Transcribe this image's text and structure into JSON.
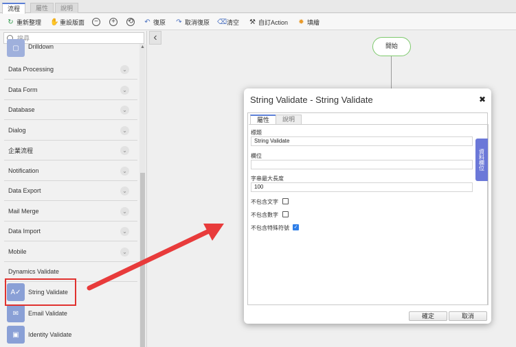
{
  "tabs": [
    {
      "label": "流程",
      "active": true
    },
    {
      "label": "屬性",
      "active": false
    },
    {
      "label": "說明",
      "active": false
    }
  ],
  "toolbar": {
    "refresh": "重新整理",
    "reset_view": "重設版面",
    "undo": "復原",
    "redo": "取消復原",
    "clear": "清空",
    "custom_action": "自訂Action",
    "color": "填繪"
  },
  "search": {
    "placeholder": "搜尋"
  },
  "sidebar": {
    "drilldown": "Drilldown",
    "categories": [
      "Data Processing",
      "Data Form",
      "Database",
      "Dialog",
      "企業流程",
      "Notification",
      "Data Export",
      "Mail Merge",
      "Data Import",
      "Mobile",
      "Dynamics Validate"
    ],
    "tools": [
      {
        "label": "String Validate",
        "icon": "string-validate-icon"
      },
      {
        "label": "Email Validate",
        "icon": "email-icon"
      },
      {
        "label": "Identity Validate",
        "icon": "identity-card-icon"
      }
    ]
  },
  "canvas": {
    "start_node": "開始"
  },
  "dialog": {
    "title": "String Validate - String Validate",
    "tabs": [
      "屬性",
      "說明"
    ],
    "side_tab": "資料欄位",
    "fields": {
      "title_label": "標題",
      "title_value": "String Validate",
      "field_label": "欄位",
      "field_value": "",
      "maxlen_label": "字串最大長度",
      "maxlen_value": "100",
      "no_text_label": "不包含文字",
      "no_text_checked": false,
      "no_digit_label": "不包含數字",
      "no_digit_checked": false,
      "no_symbol_label": "不包含特殊符號",
      "no_symbol_checked": true
    },
    "ok": "確定",
    "cancel": "取消"
  },
  "colors": {
    "accent": "#5b7fd6",
    "highlight": "#e0312e",
    "start_node_border": "#7cc96b"
  }
}
